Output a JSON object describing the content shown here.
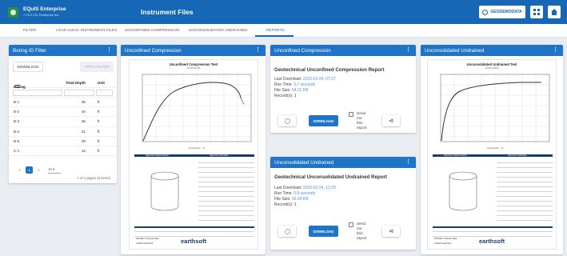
{
  "app": {
    "brand_name": "EQuIS Enterprise",
    "brand_version": "7.23.0.011 Enterprise Inc.",
    "title": "Instrument Files",
    "user_button": "GEODEMODATA"
  },
  "nav_tabs": [
    "FILTER",
    "LOAD UU/UC INSTRUMENT FILES",
    "UNCONFINED COMPRESSION",
    "UNCONSOLIDATED UNDRAINED",
    "REPORTS"
  ],
  "boring_filter": {
    "title": "Boring ID Filter",
    "download_label": "DOWNLOAD",
    "apply_label": "APPLY FILTER",
    "columns": [
      "Boring ID",
      "Total Depth",
      "Unit"
    ],
    "rows": [
      [
        "B-1",
        "36",
        "ft"
      ],
      [
        "B-2",
        "40",
        "ft"
      ],
      [
        "B-3",
        "36",
        "ft"
      ],
      [
        "B-4",
        "31",
        "ft"
      ],
      [
        "B-5",
        "25",
        "ft"
      ],
      [
        "C-1",
        "12",
        "ft"
      ]
    ],
    "pager_prev": "<",
    "pager_page": "1",
    "pager_next": ">",
    "page_size": "10",
    "pager_info": "1 of 1 pages (6 items)"
  },
  "uc_report_panel": {
    "title": "Unconfined Compression",
    "doc_title": "Unconfined Compression Test",
    "doc_sub": "ASTM D2166",
    "x_axis_label": "Axial Strain - %",
    "specimen_label": "Specimen Failure Sketch",
    "results_label": "Specimen Test Data",
    "company": "earthsoft",
    "project_label": "PROJECT: Sample Data",
    "client_label": "CLIENT: EarthSoft"
  },
  "uc_summary": {
    "title": "Unconfined Compression",
    "report_title": "Geotechnical Unconfined Compression Report",
    "last_download_label": "Last Download:",
    "last_download": "2023-02-24, 07:37",
    "run_time_label": "Run Time:",
    "run_time": "3.7 seconds",
    "file_size_label": "File Size:",
    "file_size": "54.31 KB",
    "records_label": "Record(s):",
    "records": "1",
    "download_label": "DOWNLOAD",
    "send_lines": [
      "Send",
      "me",
      "this",
      "report"
    ]
  },
  "uu_summary": {
    "title": "Unconsolidated Undrained",
    "report_title": "Geotechnical Unconsolidated Undrained Report",
    "last_download_label": "Last Download:",
    "last_download": "2023-02-24, 13:29",
    "run_time_label": "Run Time:",
    "run_time": "0.8 seconds",
    "file_size_label": "File Size:",
    "file_size": "56.54 KB",
    "records_label": "Record(s):",
    "records": "1",
    "download_label": "DOWNLOAD",
    "send_lines": [
      "Send",
      "me",
      "this",
      "report"
    ]
  },
  "uu_report_panel": {
    "title": "Unconsolidated Undrained",
    "doc_title": "Unconsolidated Undrained Test",
    "doc_sub": "ASTM D2850",
    "x_axis_label": "Axial Strain - %",
    "specimen_label": "Specimen Failure Sketch",
    "results_label": "Specimen Test Data",
    "company": "earthsoft",
    "project_label": "PROJECT: Sample Data",
    "client_label": "CLIENT: EarthSoft"
  }
}
